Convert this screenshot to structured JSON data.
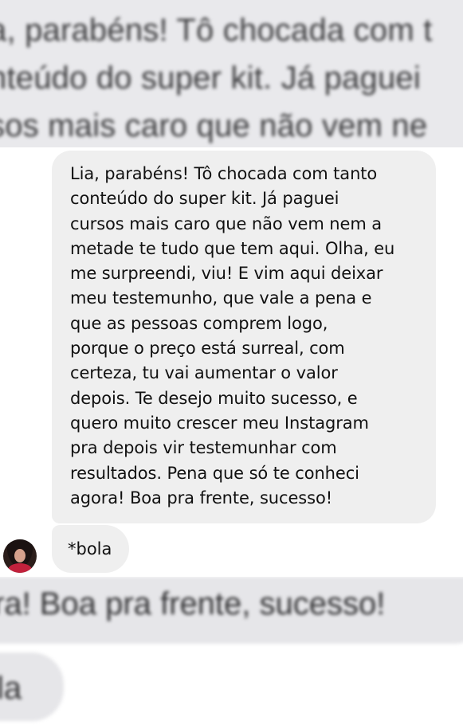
{
  "background": {
    "top_blurred_text": "a, parabéns! Tô chocada com t\nnteúdo do super kit. Já paguei\nsos mais caro que não vem ne\n  ",
    "bottom_blurred_text": "ra! Boa pra frente, sucesso!",
    "bottom_blurred_text_2": "la"
  },
  "messages": [
    {
      "text": "Lia, parabéns! Tô chocada com tanto\nconteúdo do super kit. Já paguei\ncursos mais caro que não vem nem a\nmetade te tudo que tem aqui. Olha, eu\nme surpreendi, viu! E vim aqui deixar\nmeu testemunho, que vale a pena e\nque as pessoas comprem logo,\nporque o preço está surreal, com\ncerteza, tu vai aumentar o valor\ndepois. Te desejo muito sucesso, e\nquero muito crescer meu Instagram\npra depois vir testemunhar com\nresultados. Pena que só te conheci\nagora! Boa pra frente, sucesso!"
    },
    {
      "text": "*bola"
    }
  ],
  "colors": {
    "bubble": "#efefef",
    "text": "#111111",
    "panel": "#ffffff"
  },
  "icons": {
    "avatar": "user-avatar-photo"
  }
}
